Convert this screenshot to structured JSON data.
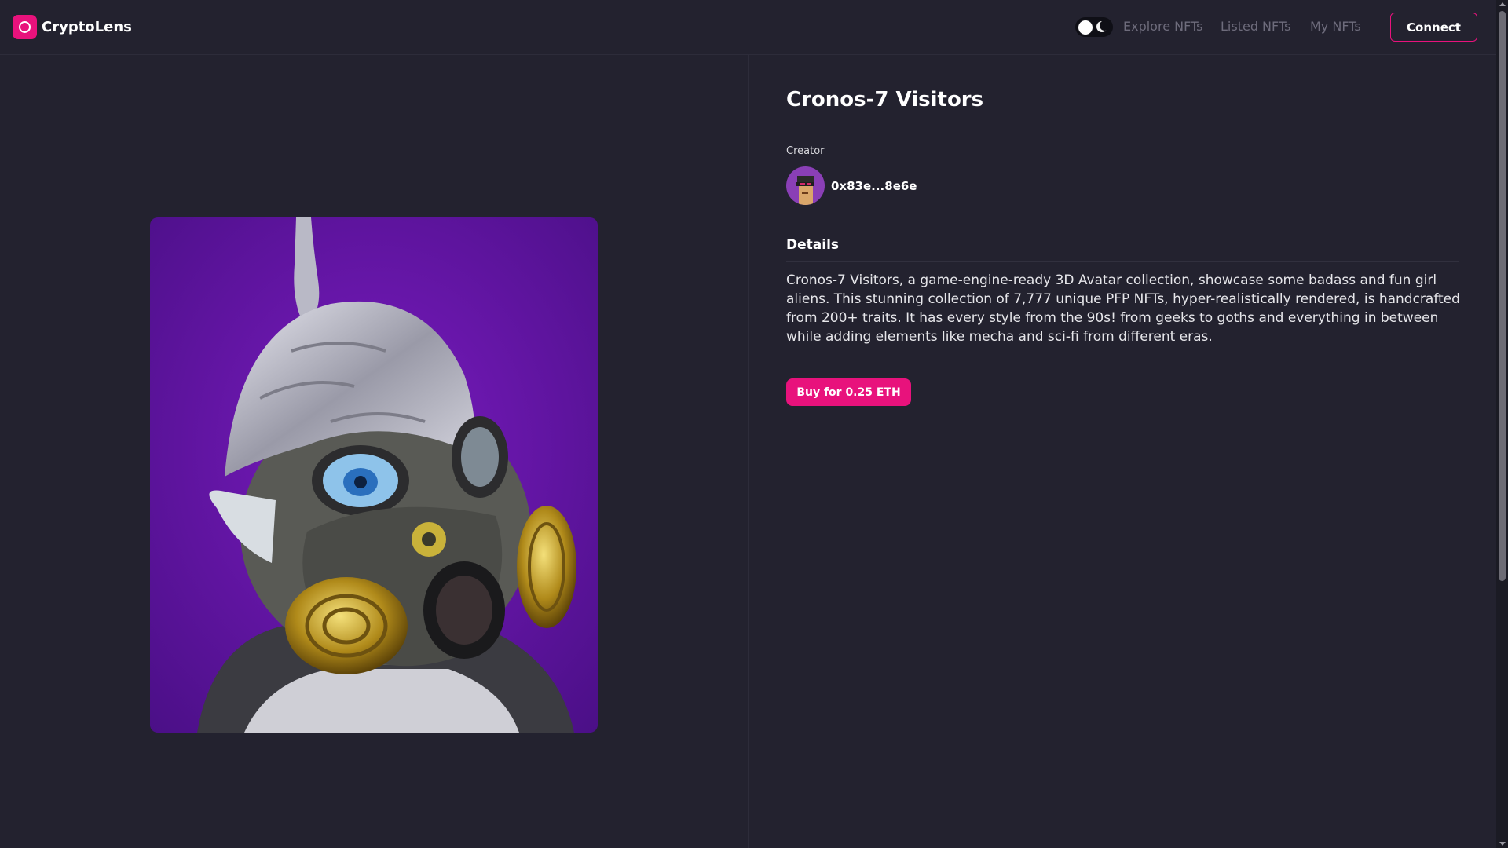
{
  "header": {
    "brand": "CryptoLens",
    "brand_icon": "camera-lens-icon",
    "theme_toggle": {
      "state": "light-selected",
      "icons": [
        "sun-knob",
        "moon-icon"
      ]
    },
    "nav": [
      "Explore NFTs",
      "Listed NFTs",
      "My NFTs"
    ],
    "connect_label": "Connect"
  },
  "nft": {
    "title": "Cronos-7 Visitors",
    "image": "alien-gas-mask-tinfoil-hat-artwork",
    "creator_label": "Creator",
    "creator_address": "0x83e...8e6e",
    "details_heading": "Details",
    "description": "Cronos-7 Visitors, a game-engine-ready 3D Avatar collection, showcase some badass and fun girl aliens. This stunning collection of 7,777 unique PFP NFTs, hyper-realistically rendered, is handcrafted from 200+ traits. It has every style from the 90s! from geeks to goths and everything in between while adding elements like mecha and sci-fi from different eras.",
    "buy_label": "Buy for 0.25 ETH"
  },
  "colors": {
    "background": "#23222f",
    "accent": "#e8127c",
    "nav_text": "#6e6c7c"
  }
}
